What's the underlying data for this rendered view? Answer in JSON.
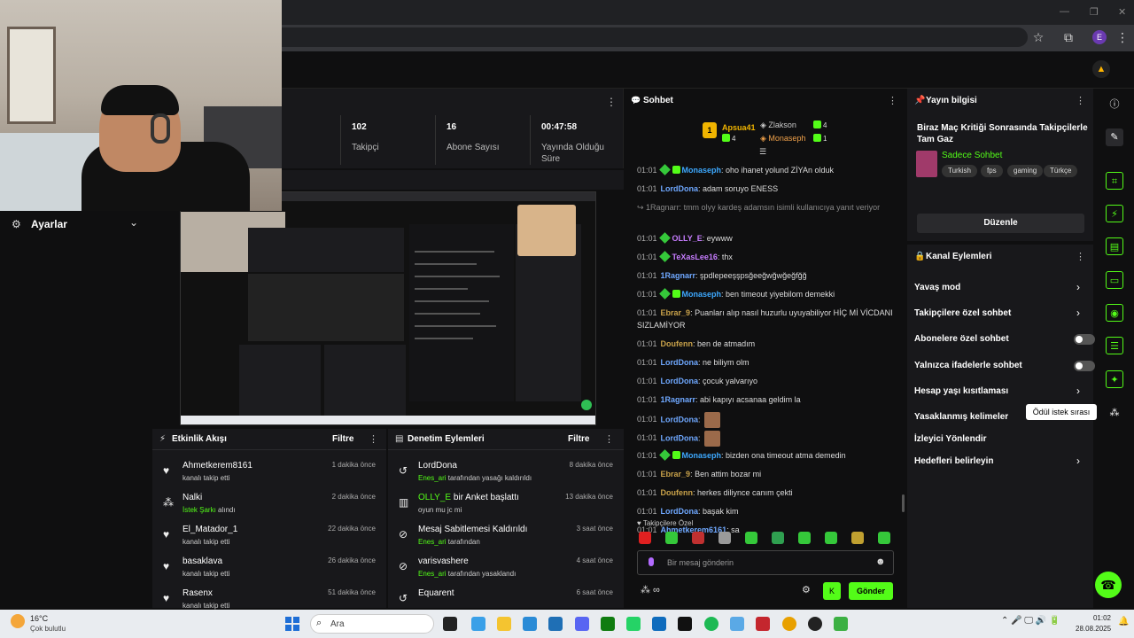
{
  "browser": {
    "window_controls": [
      "—",
      "❐",
      "✕"
    ],
    "toolbar_icons": [
      "bookmark-star-icon",
      "extensions-icon",
      "menu-icon"
    ],
    "profile_initial": "E"
  },
  "settings": {
    "label": "Ayarlar"
  },
  "stats": {
    "items": [
      {
        "value": "102",
        "label": "Takipçi"
      },
      {
        "value": "16",
        "label": "Abone Sayısı"
      },
      {
        "value": "00:47:58",
        "label": "Yayında Olduğu Süre"
      }
    ]
  },
  "events": {
    "title": "Etkinlik Akışı",
    "filter": "Filtre",
    "items": [
      {
        "icon": "heart-icon",
        "name": "Ahmetkerem8161",
        "sub": "kanalı takip etti",
        "time": "1 dakika önce"
      },
      {
        "icon": "reward-icon",
        "name": "Nalki",
        "sub_green": "İstek Şarkı",
        "sub": " alındı",
        "time": "2 dakika önce"
      },
      {
        "icon": "heart-icon",
        "name": "El_Matador_1",
        "sub": "kanalı takip etti",
        "time": "22 dakika önce"
      },
      {
        "icon": "heart-icon",
        "name": "basaklava",
        "sub": "kanalı takip etti",
        "time": "26 dakika önce"
      },
      {
        "icon": "heart-icon",
        "name": "Rasenx",
        "sub": "kanalı takip etti",
        "time": "51 dakika önce"
      }
    ]
  },
  "modlog": {
    "title": "Denetim Eylemleri",
    "filter": "Filtre",
    "items": [
      {
        "icon": "undo-icon",
        "name": "LordDona",
        "sub_green": "Enes_ari",
        "sub": " tarafından yasağı kaldırıldı",
        "time": "8 dakika önce"
      },
      {
        "icon": "poll-icon",
        "name_green": "OLLY_E",
        "name": " bir Anket başlattı",
        "sub": "oyun mu jc mi",
        "time": "13 dakika önce"
      },
      {
        "icon": "unpin-icon",
        "name": "Mesaj Sabitlemesi Kaldırıldı",
        "sub_green": "Enes_ari",
        "sub": " tarafından",
        "time": "3 saat önce"
      },
      {
        "icon": "ban-icon",
        "name": "varisvashere",
        "sub_green": "Enes_ari",
        "sub": " tarafından yasaklandı",
        "time": "4 saat önce"
      },
      {
        "icon": "undo-icon",
        "name": "Equarent",
        "sub_green": "",
        "sub": "",
        "time": "6 saat önce"
      }
    ]
  },
  "chat": {
    "title": "Sohbet",
    "leaderboard": [
      {
        "rank": "1",
        "name": "Apsua41",
        "count": "4"
      },
      {
        "rank": "",
        "name": "Zlakson",
        "count": "4"
      },
      {
        "rank": "",
        "name": "Monaseph",
        "count": "1"
      }
    ],
    "messages": [
      {
        "time": "01:01",
        "badges": 2,
        "user": "Monaseph",
        "color": "#3da9ff",
        "text": ": oho ihanet yolund ZİYAn olduk"
      },
      {
        "time": "01:01",
        "badges": 0,
        "user": "LordDona",
        "color": "#6fa8ff",
        "text": ": adam soruyo ENESS"
      },
      {
        "time": "",
        "badges": 0,
        "user": "",
        "color": "#888",
        "text": "↪ 1Ragnarr: tmm olyy kardeş adamsın isimli kullanıcıya yanıt veriyor"
      },
      {
        "time": "01:01",
        "badges": 1,
        "user": "OLLY_E",
        "color": "#c77dff",
        "text": ": eywww"
      },
      {
        "time": "01:01",
        "badges": 1,
        "user": "TeXasLee16",
        "color": "#c77dff",
        "text": ": thx"
      },
      {
        "time": "01:01",
        "badges": 0,
        "user": "1Ragnarr",
        "color": "#6fa8ff",
        "text": ": şpdlepeeşşpsğeeğwğwğeğfğğ"
      },
      {
        "time": "01:01",
        "badges": 2,
        "user": "Monaseph",
        "color": "#3da9ff",
        "text": ": ben timeout yiyebilom demekki"
      },
      {
        "time": "01:01",
        "badges": 0,
        "user": "Ebrar_9",
        "color": "#c9a24a",
        "text": ": Puanları alıp nasıl huzurlu uyuyabiliyor HİÇ Mİ VİCDANI SIZLAMİYOR"
      },
      {
        "time": "01:01",
        "badges": 0,
        "user": "Doufenn",
        "color": "#c9a24a",
        "text": ": ben de atmadım"
      },
      {
        "time": "01:01",
        "badges": 0,
        "user": "LordDona",
        "color": "#6fa8ff",
        "text": ": ne biliym olm"
      },
      {
        "time": "01:01",
        "badges": 0,
        "user": "LordDona",
        "color": "#6fa8ff",
        "text": ": çocuk yalvarıyo"
      },
      {
        "time": "01:01",
        "badges": 0,
        "user": "1Ragnarr",
        "color": "#6fa8ff",
        "text": ": abi kapıyı acsanaa geldim la"
      },
      {
        "time": "01:01",
        "badges": 0,
        "user": "LordDona",
        "color": "#6fa8ff",
        "text": ":",
        "emote": true
      },
      {
        "time": "01:01",
        "badges": 0,
        "user": "LordDona",
        "color": "#6fa8ff",
        "text": ":",
        "emote": true
      },
      {
        "time": "01:01",
        "badges": 2,
        "user": "Monaseph",
        "color": "#3da9ff",
        "text": ": bizden ona timeout atma demedin"
      },
      {
        "time": "01:01",
        "badges": 0,
        "user": "Ebrar_9",
        "color": "#c9a24a",
        "text": ": Ben attim bozar mi"
      },
      {
        "time": "01:01",
        "badges": 0,
        "user": "Doufenn",
        "color": "#c9a24a",
        "text": ": herkes diliynce canım çekti"
      },
      {
        "time": "01:01",
        "badges": 0,
        "user": "LordDona",
        "color": "#6fa8ff",
        "text": ": başak kim"
      },
      {
        "time": "01:01",
        "badges": 0,
        "user": "Ahmetkerem6161",
        "color": "#6fa8ff",
        "text": ": sa"
      }
    ],
    "followers_only": "Takipçilere Özel",
    "placeholder": "Bir mesaj gönderin",
    "send": "Gönder"
  },
  "stream_info": {
    "title": "Yayın bilgisi",
    "stream_title": "Biraz Maç Kritiği Sonrasında Takipçilerle Tam Gaz",
    "category": "Sadece Sohbet",
    "tags": [
      "Turkish",
      "fps",
      "gaming",
      "Türkçe"
    ],
    "edit": "Düzenle"
  },
  "channel_actions": {
    "title": "Kanal Eylemleri",
    "items": [
      {
        "label": "Yavaş mod",
        "type": "chevron"
      },
      {
        "label": "Takipçilere özel sohbet",
        "type": "chevron"
      },
      {
        "label": "Abonelere özel sohbet",
        "type": "toggle"
      },
      {
        "label": "Yalnızca ifadelerle sohbet",
        "type": "toggle"
      },
      {
        "label": "Hesap yaşı kısıtlaması",
        "type": "chevron"
      },
      {
        "label": "Yasaklanmış kelimeler",
        "type": "none"
      },
      {
        "label": "İzleyici Yönlendir",
        "type": "none"
      },
      {
        "label": "Hedefleri belirleyin",
        "type": "chevron"
      }
    ]
  },
  "tooltip": "Ödül istek sırası",
  "taskbar": {
    "temp": "16°C",
    "weather": "Çok bulutlu",
    "search": "Ara",
    "time": "01:02",
    "date": "28.08.2025"
  },
  "colors": {
    "accent": "#53fc18",
    "panel": "#18181b",
    "bg": "#0f0f10"
  }
}
